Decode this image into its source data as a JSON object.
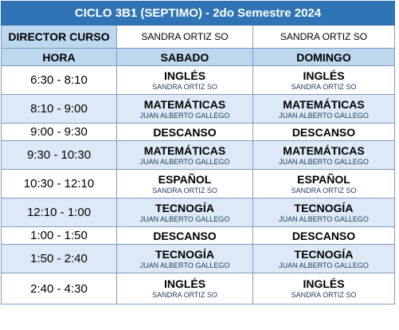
{
  "title": "CICLO 3B1 (SEPTIMO) - 2do Semestre 2024",
  "director": {
    "label": "DIRECTOR CURSO",
    "sabado": "SANDRA ORTIZ SO",
    "domingo": "SANDRA ORTIZ SO"
  },
  "headers": {
    "hora": "HORA",
    "sabado": "SABADO",
    "domingo": "DOMINGO"
  },
  "rows": [
    {
      "hora": "6:30 - 8:10",
      "sab_subject": "INGLÉS",
      "sab_teacher": "SANDRA ORTIZ SO",
      "dom_subject": "INGLÉS",
      "dom_teacher": "SANDRA ORTIZ SO"
    },
    {
      "hora": "8:10 - 9:00",
      "sab_subject": "MATEMÁTICAS",
      "sab_teacher": "JUAN ALBERTO GALLEGO",
      "dom_subject": "MATEMÁTICAS",
      "dom_teacher": "JUAN ALBERTO GALLEGO"
    },
    {
      "hora": "9:00 - 9:30",
      "sab_subject": "DESCANSO",
      "dom_subject": "DESCANSO"
    },
    {
      "hora": "9:30 - 10:30",
      "sab_subject": "MATEMÁTICAS",
      "sab_teacher": "JUAN ALBERTO GALLEGO",
      "dom_subject": "MATEMÁTICAS",
      "dom_teacher": "JUAN ALBERTO GALLEGO"
    },
    {
      "hora": "10:30 - 12:10",
      "sab_subject": "ESPAÑOL",
      "sab_teacher": "SANDRA ORTIZ SO",
      "dom_subject": "ESPAÑOL",
      "dom_teacher": "SANDRA ORTIZ SO"
    },
    {
      "hora": "12:10 - 1:00",
      "sab_subject": "TECNOGÍA",
      "sab_teacher": "JUAN ALBERTO GALLEGO",
      "dom_subject": "TECNOGÍA",
      "dom_teacher": "JUAN ALBERTO GALLEGO"
    },
    {
      "hora": "1:00 - 1:50",
      "sab_subject": "DESCANSO",
      "dom_subject": "DESCANSO"
    },
    {
      "hora": "1:50 - 2:40",
      "sab_subject": "TECNOGÍA",
      "sab_teacher": "JUAN ALBERTO GALLEGO",
      "dom_subject": "TECNOGÍA",
      "dom_teacher": "JUAN ALBERTO GALLEGO"
    },
    {
      "hora": "2:40 - 4:30",
      "sab_subject": "INGLÉS",
      "sab_teacher": "SANDRA ORTIZ SO",
      "dom_subject": "INGLÉS",
      "dom_teacher": "SANDRA ORTIZ SO"
    }
  ],
  "colors": {
    "title_bg": "#2f75b5",
    "header_bg": "#bdd7ee",
    "alt_row_bg": "#dde9f6",
    "border": "#7f9bbf"
  }
}
